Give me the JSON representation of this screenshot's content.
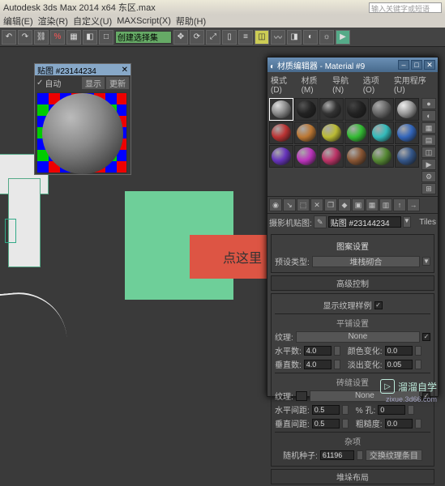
{
  "app": {
    "title": "Autodesk 3ds Max 2014 x64   东区.max",
    "search_placeholder": "输入关键字或短语"
  },
  "menu": {
    "edit": "编辑(E)",
    "render": "渲染(R)",
    "custom": "自定义(U)",
    "maxscript": "MAXScript(X)",
    "help": "帮助(H)"
  },
  "toolbar": {
    "dropdown": "创建选择集",
    "percent": "%"
  },
  "sphere_panel": {
    "title": "贴图 #23144234",
    "close": "✕",
    "auto": "自动",
    "tab1": "显示",
    "tab2": "更新"
  },
  "arrow": {
    "label": "点这里"
  },
  "mat": {
    "title": "材质编辑器 - Material #9",
    "menu": {
      "mode": "模式(D)",
      "material": "材质(M)",
      "nav": "导航(N)",
      "opts": "选项(O)",
      "util": "实用程序(U)"
    },
    "win": {
      "min": "–",
      "max": "□",
      "close": "✕"
    },
    "name_label": "摄影机贴图:",
    "name_value": "贴图 #23144234",
    "tiles": "Tiles",
    "sec_pattern": "图案设置",
    "preset_label": "预设类型:",
    "preset_value": "堆栈砌合",
    "sec_adv": "高级控制",
    "show_sample": "显示纹理样例",
    "tile_label": "平铺设置",
    "texture": "纹理:",
    "none": "None",
    "hcount": "水平数:",
    "hcount_v": "4.0",
    "vcount": "垂直数:",
    "vcount_v": "4.0",
    "colvar": "颜色变化:",
    "colvar_v": "0.0",
    "fade": "淡出变化:",
    "fadein_v": "0.05",
    "sec_gap": "砖缝设置",
    "gap_tex": "纹理:",
    "hgap": "水平间距:",
    "hgap_v": "0.5",
    "vgap": "垂直间距:",
    "vgap_v": "0.5",
    "hole": "% 孔:",
    "hole_v": "0",
    "rough": "粗糙度:",
    "rough_v": "0.0",
    "sec_misc": "杂项",
    "seed": "随机种子:",
    "seed_v": "61196",
    "swap": "交换纹理条目",
    "sec_stack": "堆垛布局"
  },
  "watermark": {
    "text": "溜溜自学",
    "url": "zixue.3d66.com",
    "icon": "▷"
  }
}
